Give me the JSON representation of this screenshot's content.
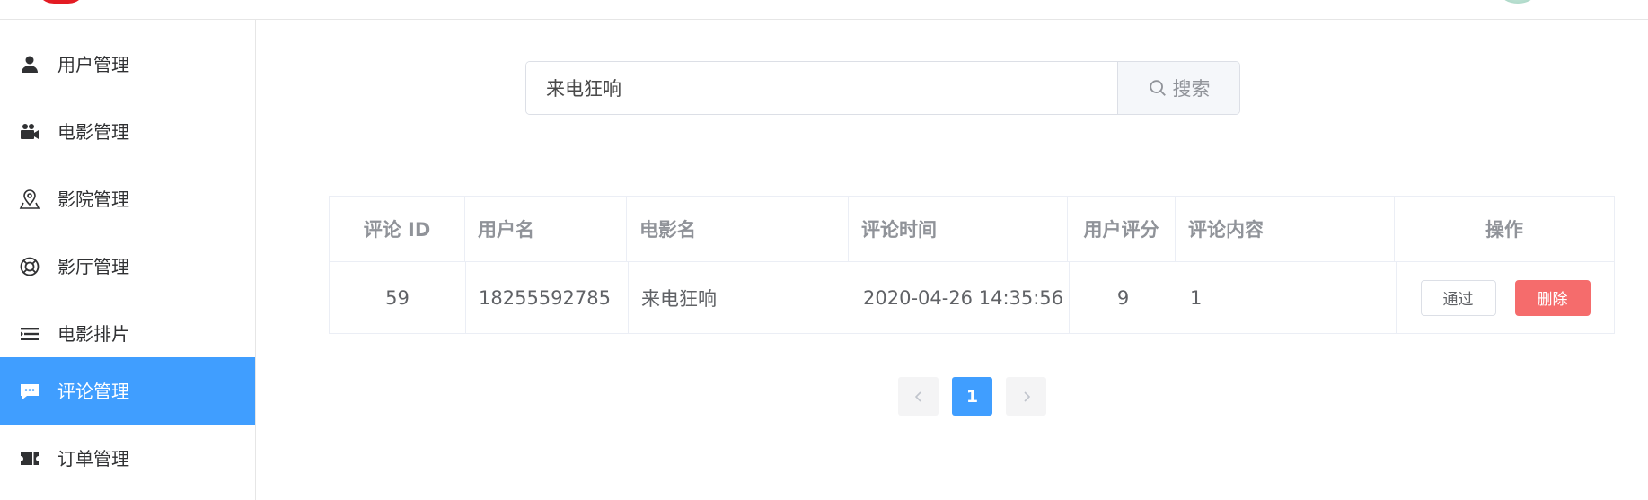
{
  "sidebar": {
    "items": [
      {
        "label": "用户管理",
        "icon": "user-icon",
        "active": false
      },
      {
        "label": "电影管理",
        "icon": "video-camera-icon",
        "active": false
      },
      {
        "label": "影院管理",
        "icon": "location-pin-icon",
        "active": false
      },
      {
        "label": "影厅管理",
        "icon": "lifebuoy-icon",
        "active": false
      },
      {
        "label": "电影排片",
        "icon": "list-icon",
        "active": false
      },
      {
        "label": "评论管理",
        "icon": "chat-bubble-icon",
        "active": true
      },
      {
        "label": "订单管理",
        "icon": "ticket-icon",
        "active": false
      }
    ]
  },
  "search": {
    "value": "来电狂响",
    "button_label": "搜索",
    "icon": "search-icon"
  },
  "table": {
    "columns": [
      "评论 ID",
      "用户名",
      "电影名",
      "评论时间",
      "用户评分",
      "评论内容",
      "操作"
    ],
    "rows": [
      {
        "id": "59",
        "username": "18255592785",
        "movie": "来电狂响",
        "time": "2020-04-26 14:35:56",
        "rating": "9",
        "content": "1",
        "approve_label": "通过",
        "delete_label": "删除"
      }
    ]
  },
  "pagination": {
    "current_page": "1",
    "prev_icon": "chevron-left-icon",
    "next_icon": "chevron-right-icon"
  },
  "colors": {
    "primary": "#409eff",
    "danger": "#f56c6c",
    "header_text": "#909399",
    "body_text": "#606266"
  }
}
